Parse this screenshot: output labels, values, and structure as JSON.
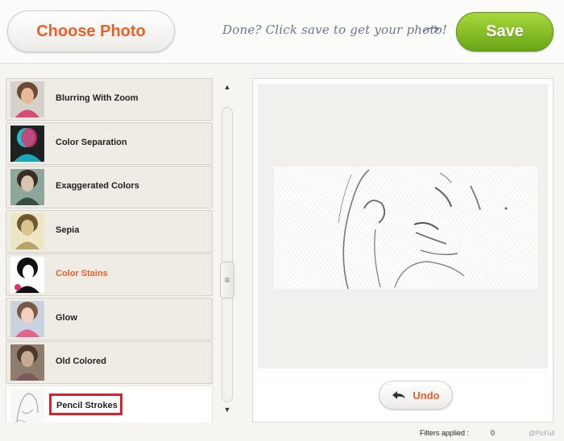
{
  "header": {
    "choose_label": "Choose Photo",
    "hint": "Done? Click save to get your photo!",
    "save_label": "Save"
  },
  "filters": [
    {
      "label": "Blurring With Zoom",
      "thumb": "portrait-blur"
    },
    {
      "label": "Color Separation",
      "thumb": "portrait-color-separation"
    },
    {
      "label": "Exaggerated Colors",
      "thumb": "portrait-exaggerated"
    },
    {
      "label": "Sepia",
      "thumb": "portrait-sepia"
    },
    {
      "label": "Color Stains",
      "thumb": "portrait-color-stains",
      "highlight": true
    },
    {
      "label": "Glow",
      "thumb": "portrait-glow"
    },
    {
      "label": "Old Colored",
      "thumb": "portrait-old-colored"
    },
    {
      "label": "Pencil Strokes",
      "thumb": "portrait-pencil",
      "selected": true
    }
  ],
  "scrollbar": {
    "up": "▲",
    "down": "▼",
    "grip": "≡"
  },
  "preview": {
    "undo_label": "Undo"
  },
  "footer": {
    "filters_label": "Filters applied :",
    "filters_count": "0",
    "brand": "@PicFull"
  },
  "colors": {
    "accent_orange": "#e8602a",
    "save_green": "#7cb82f",
    "highlight_red": "#d8232a"
  }
}
